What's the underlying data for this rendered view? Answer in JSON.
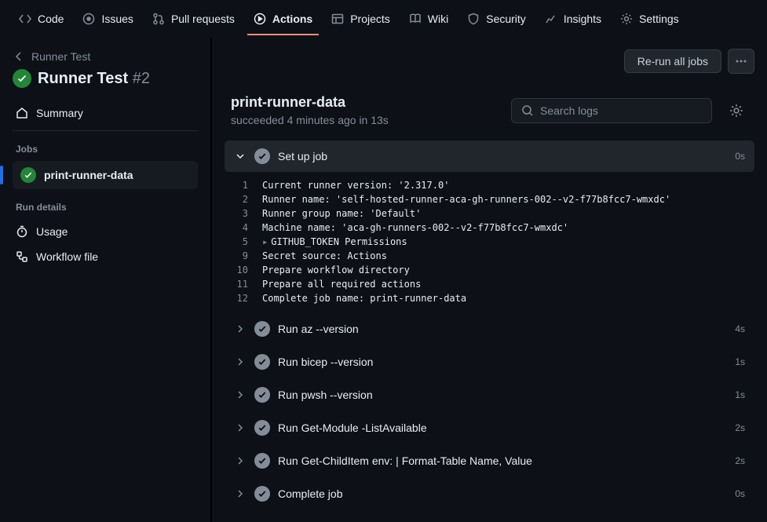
{
  "nav": {
    "code": "Code",
    "issues": "Issues",
    "pulls": "Pull requests",
    "actions": "Actions",
    "projects": "Projects",
    "wiki": "Wiki",
    "security": "Security",
    "insights": "Insights",
    "settings": "Settings"
  },
  "sidebar": {
    "breadcrumb": "Runner Test",
    "title": "Runner Test",
    "run_number": "#2",
    "summary": "Summary",
    "jobs_label": "Jobs",
    "job_name": "print-runner-data",
    "details_label": "Run details",
    "usage": "Usage",
    "workflow_file": "Workflow file"
  },
  "header": {
    "rerun": "Re-run all jobs"
  },
  "job": {
    "name": "print-runner-data",
    "meta": "succeeded 4 minutes ago in 13s",
    "search_placeholder": "Search logs"
  },
  "steps": [
    {
      "name": "Set up job",
      "time": "0s",
      "expanded": true
    },
    {
      "name": "Run az --version",
      "time": "4s",
      "expanded": false
    },
    {
      "name": "Run bicep --version",
      "time": "1s",
      "expanded": false
    },
    {
      "name": "Run pwsh --version",
      "time": "1s",
      "expanded": false
    },
    {
      "name": "Run Get-Module -ListAvailable",
      "time": "2s",
      "expanded": false
    },
    {
      "name": "Run Get-ChildItem env: | Format-Table Name, Value",
      "time": "2s",
      "expanded": false
    },
    {
      "name": "Complete job",
      "time": "0s",
      "expanded": false
    }
  ],
  "log": [
    {
      "n": "1",
      "t": "Current runner version: '2.317.0'"
    },
    {
      "n": "2",
      "t": "Runner name: 'self-hosted-runner-aca-gh-runners-002--v2-f77b8fcc7-wmxdc'"
    },
    {
      "n": "3",
      "t": "Runner group name: 'Default'"
    },
    {
      "n": "4",
      "t": "Machine name: 'aca-gh-runners-002--v2-f77b8fcc7-wmxdc'"
    },
    {
      "n": "5",
      "t": "GITHUB_TOKEN Permissions",
      "caret": true
    },
    {
      "n": "9",
      "t": "Secret source: Actions"
    },
    {
      "n": "10",
      "t": "Prepare workflow directory"
    },
    {
      "n": "11",
      "t": "Prepare all required actions"
    },
    {
      "n": "12",
      "t": "Complete job name: print-runner-data"
    }
  ]
}
